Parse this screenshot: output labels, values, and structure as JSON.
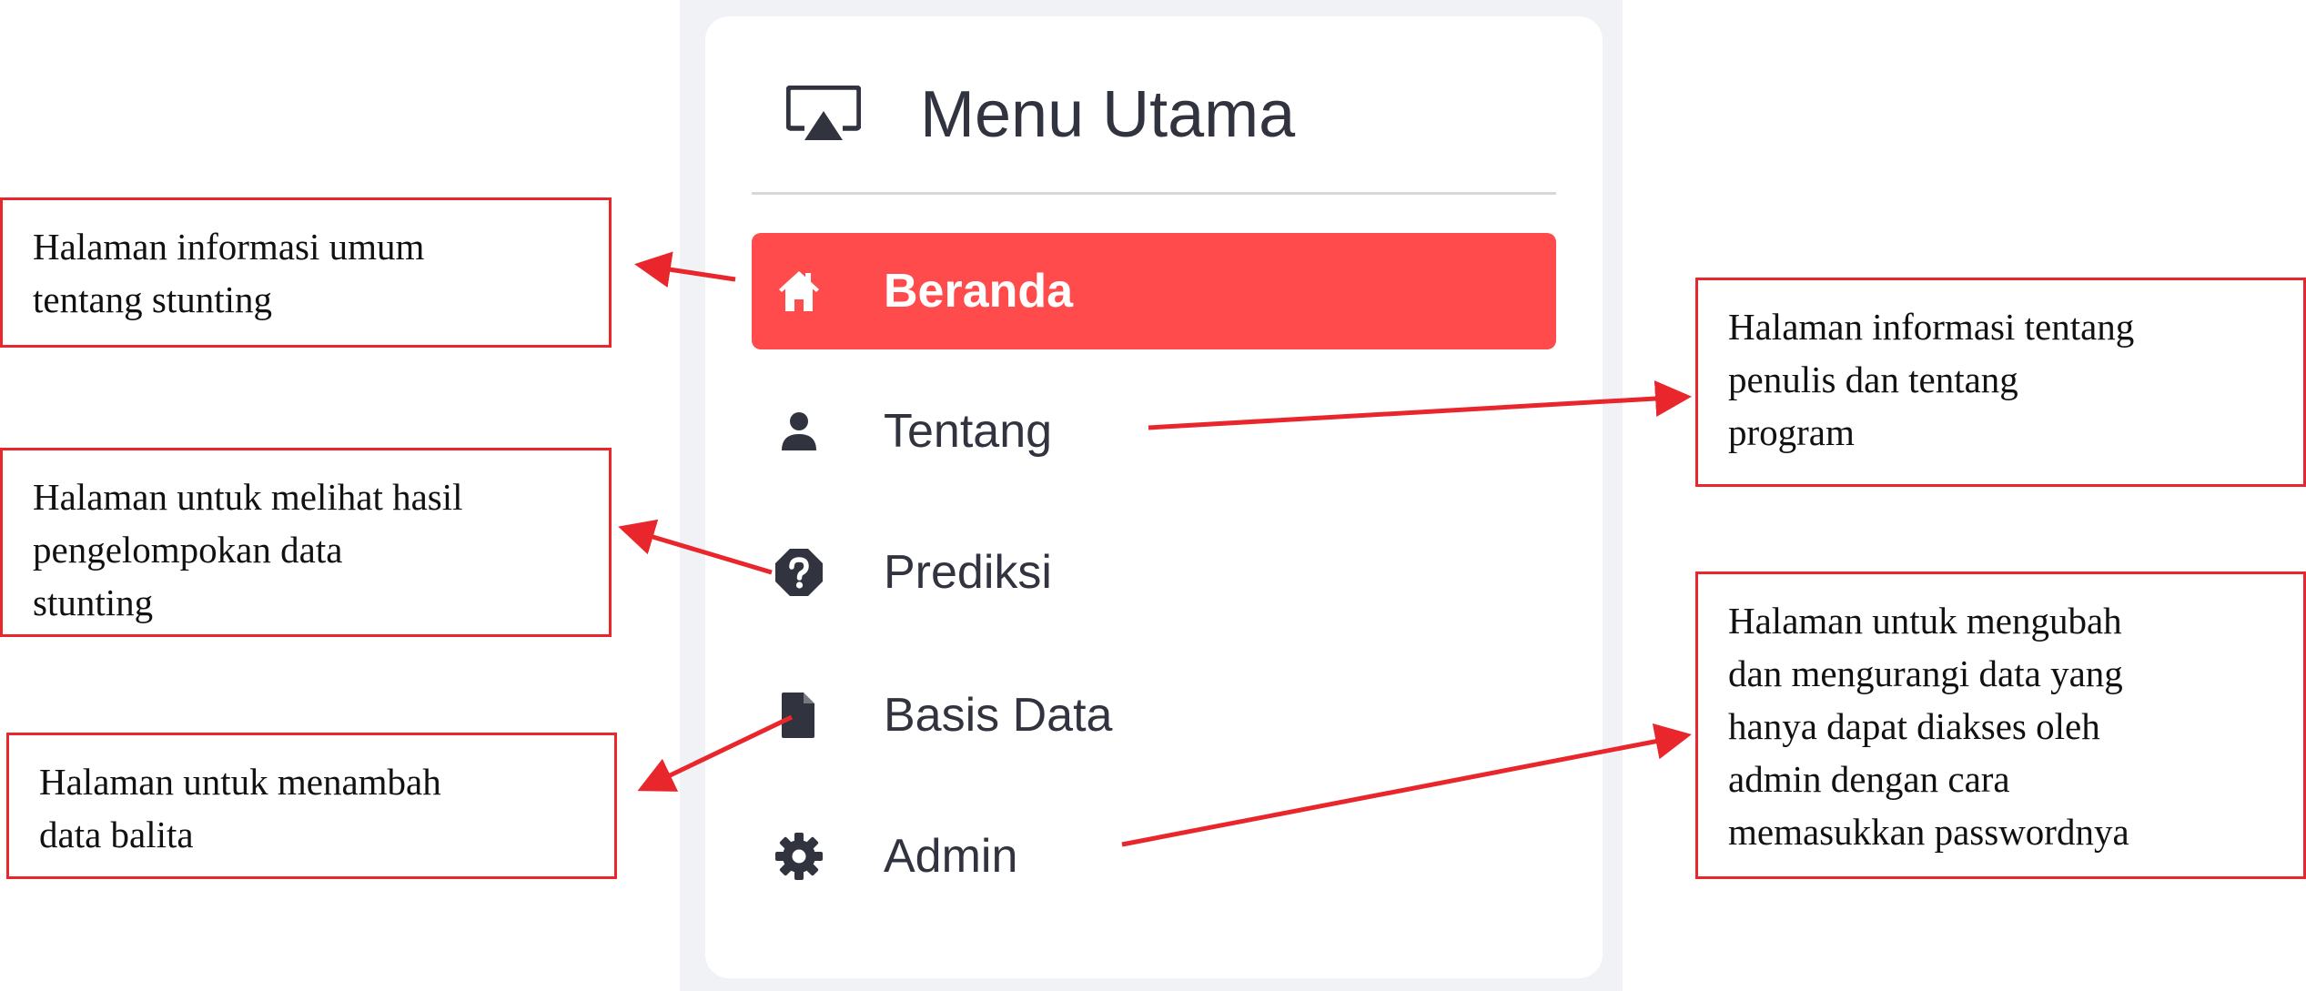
{
  "colors": {
    "accent": "#ff4b4b",
    "panel_background": "#f0f2f6",
    "text": "#31333f",
    "annotation": "#e8262b"
  },
  "sidebar": {
    "header_icon": "airplay-icon",
    "title": "Menu Utama",
    "items": [
      {
        "label": "Beranda",
        "icon": "house-icon",
        "active": true
      },
      {
        "label": "Tentang",
        "icon": "person-icon",
        "active": false
      },
      {
        "label": "Prediksi",
        "icon": "question-octagon-icon",
        "active": false
      },
      {
        "label": "Basis Data",
        "icon": "file-icon",
        "active": false
      },
      {
        "label": "Admin",
        "icon": "gear-icon",
        "active": false
      }
    ]
  },
  "annotations": [
    {
      "target": "Beranda",
      "lines": [
        "Halaman informasi umum",
        "tentang stunting"
      ]
    },
    {
      "target": "Prediksi",
      "lines": [
        "Halaman untuk melihat hasil",
        "pengelompokan data",
        "stunting"
      ]
    },
    {
      "target": "Basis Data",
      "lines": [
        "Halaman untuk menambah",
        "data balita"
      ]
    },
    {
      "target": "Tentang",
      "lines": [
        "Halaman informasi tentang",
        "penulis dan tentang",
        "program"
      ]
    },
    {
      "target": "Admin",
      "lines": [
        "Halaman untuk mengubah",
        "dan mengurangi data yang",
        "hanya dapat diakses oleh",
        "admin dengan cara",
        "memasukkan passwordnya"
      ]
    }
  ]
}
